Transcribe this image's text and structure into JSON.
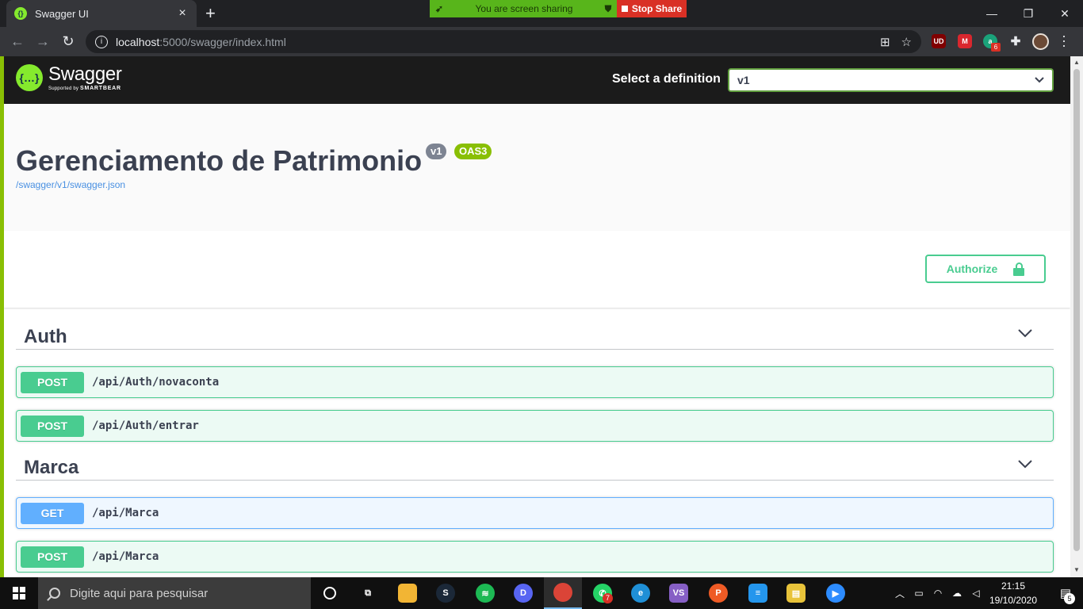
{
  "browser": {
    "tab_title": "Swagger UI",
    "tab_close": "×",
    "new_tab": "+",
    "share_text": "You are screen sharing",
    "stop_share": "Stop Share",
    "url_host": "localhost",
    "url_path": ":5000/swagger/index.html",
    "minimize": "—",
    "maximize": "❐",
    "close": "✕",
    "extensions": [
      {
        "name": "ublock",
        "label": "UD",
        "color": "#800000"
      },
      {
        "name": "mega",
        "label": "M",
        "color": "#d9272e"
      },
      {
        "name": "ext-green",
        "label": "a",
        "color": "#1aa37a"
      }
    ],
    "ext_badge": "6"
  },
  "swagger": {
    "brand": "Swagger",
    "supported_by": "Supported by",
    "smartbear": "SMARTBEAR",
    "definition_label": "Select a definition",
    "definition_value": "v1",
    "title": "Gerenciamento de Patrimonio",
    "version_badge": "v1",
    "oas_badge": "OAS3",
    "spec_url": "/swagger/v1/swagger.json",
    "authorize_label": "Authorize",
    "tags": [
      {
        "name": "Auth",
        "operations": [
          {
            "method": "POST",
            "path": "/api/Auth/novaconta"
          },
          {
            "method": "POST",
            "path": "/api/Auth/entrar"
          }
        ]
      },
      {
        "name": "Marca",
        "operations": [
          {
            "method": "GET",
            "path": "/api/Marca"
          },
          {
            "method": "POST",
            "path": "/api/Marca"
          }
        ]
      }
    ]
  },
  "taskbar": {
    "search_placeholder": "Digite aqui para pesquisar",
    "whatsapp_badge": "7",
    "time": "21:15",
    "date": "19/10/2020",
    "notification_count": "5",
    "apps": [
      {
        "name": "task-view",
        "label": "⧉",
        "color": "#101010"
      },
      {
        "name": "file-explorer",
        "label": "",
        "color": "#f2b534"
      },
      {
        "name": "steam",
        "label": "S",
        "color": "#1b2838"
      },
      {
        "name": "spotify",
        "label": "≋",
        "color": "#1db954"
      },
      {
        "name": "discord",
        "label": "D",
        "color": "#5865f2"
      },
      {
        "name": "chrome",
        "label": "",
        "color": "#db4437"
      },
      {
        "name": "whatsapp",
        "label": "✆",
        "color": "#25d366"
      },
      {
        "name": "edge",
        "label": "e",
        "color": "#1f8fd6"
      },
      {
        "name": "visual-studio",
        "label": "VS",
        "color": "#865fc5"
      },
      {
        "name": "postman",
        "label": "P",
        "color": "#ef5b25"
      },
      {
        "name": "docker",
        "label": "≡",
        "color": "#2496ed"
      },
      {
        "name": "app-yellow",
        "label": "▤",
        "color": "#e8c33a"
      },
      {
        "name": "zoom",
        "label": "▶",
        "color": "#2d8cff"
      }
    ]
  }
}
